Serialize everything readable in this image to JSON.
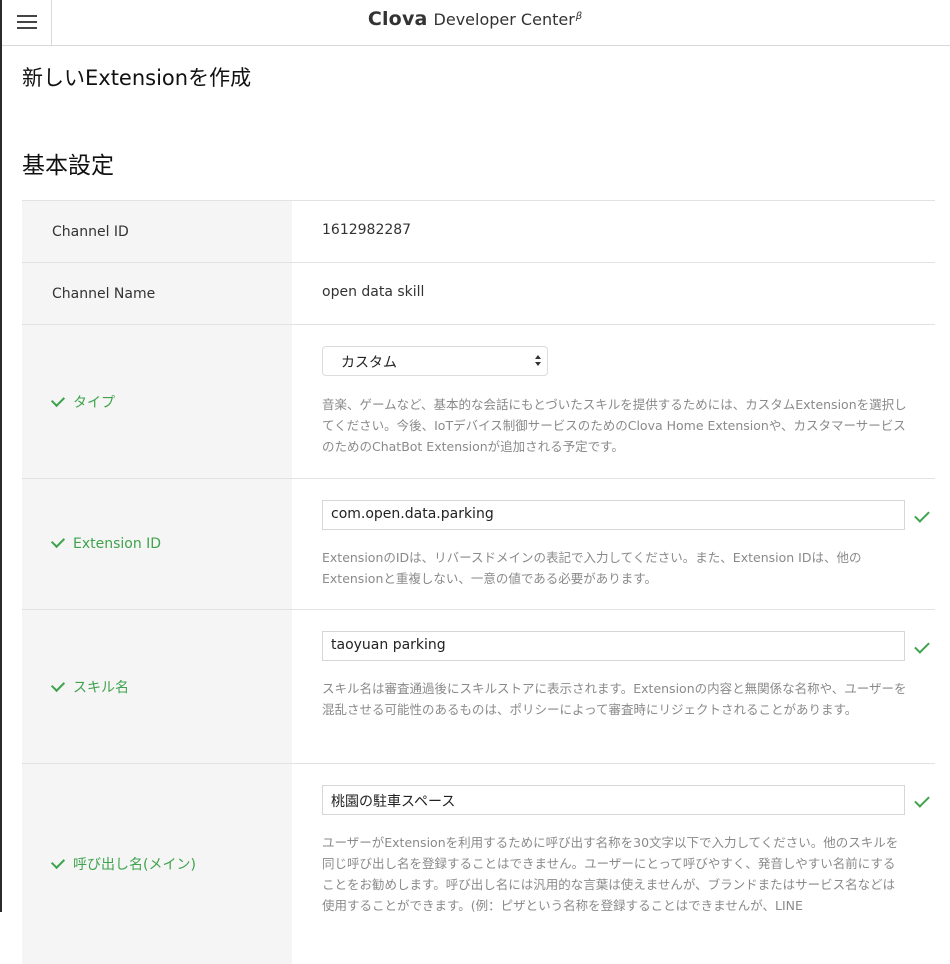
{
  "header": {
    "brand_main": "Clova",
    "brand_sub": "Developer Center",
    "brand_beta": "β"
  },
  "page_title": "新しいExtensionを作成",
  "section_title": "基本設定",
  "fields": {
    "channel_id": {
      "label": "Channel ID",
      "value": "1612982287"
    },
    "channel_name": {
      "label": "Channel Name",
      "value": "open data skill"
    },
    "type": {
      "label": "タイプ",
      "selected": "カスタム",
      "help": "音楽、ゲームなど、基本的な会話にもとづいたスキルを提供するためには、カスタムExtensionを選択してください。今後、IoTデバイス制御サービスのためのClova Home Extensionや、カスタマーサービスのためのChatBot Extensionが追加される予定です。"
    },
    "extension_id": {
      "label": "Extension ID",
      "value": "com.open.data.parking",
      "help": "ExtensionのIDは、リバースドメインの表記で入力してください。また、Extension IDは、他のExtensionと重複しない、一意の値である必要があります。"
    },
    "skill_name": {
      "label": "スキル名",
      "value": "taoyuan parking",
      "help": "スキル名は審査通過後にスキルストアに表示されます。Extensionの内容と無関係な名称や、ユーザーを混乱させる可能性のあるものは、ポリシーによって審査時にリジェクトされることがあります。"
    },
    "invocation_name": {
      "label": "呼び出し名(メイン)",
      "value": "桃園の駐車スペース",
      "help": "ユーザーがExtensionを利用するために呼び出す名称を30文字以下で入力してください。他のスキルを同じ呼び出し名を登録することはできません。ユーザーにとって呼びやすく、発音しやすい名前にすることをお勧めします。呼び出し名には汎用的な言葉は使えませんが、ブランドまたはサービス名などは使用することができます。(例：ピザという名称を登録することはできませんが、LINE"
    }
  },
  "colors": {
    "valid_green": "#3fa34d",
    "label_bg": "#f5f5f5",
    "help_text": "#8a8a8a"
  }
}
